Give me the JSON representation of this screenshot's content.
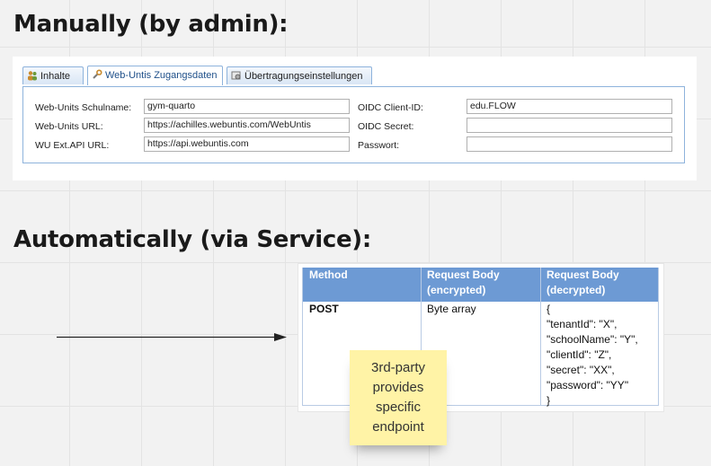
{
  "headings": {
    "manual": "Manually (by admin):",
    "automatic": "Automatically (via Service):"
  },
  "tabs": [
    {
      "label": "Inhalte",
      "icon": "people-icon",
      "active": false
    },
    {
      "label": "Web-Untis Zugangsdaten",
      "icon": "wrench-icon",
      "active": true
    },
    {
      "label": "Übertragungseinstellungen",
      "icon": "transfer-settings-icon",
      "active": false
    }
  ],
  "form": {
    "left": [
      {
        "label": "Web-Units Schulname:",
        "value": "gym-quarto"
      },
      {
        "label": "Web-Units URL:",
        "value": "https://achilles.webuntis.com/WebUntis"
      },
      {
        "label": "WU Ext.API URL:",
        "value": "https://api.webuntis.com"
      }
    ],
    "right": [
      {
        "label": "OIDC Client-ID:",
        "value": "edu.FLOW"
      },
      {
        "label": "OIDC Secret:",
        "value": ""
      },
      {
        "label": "Passwort:",
        "value": ""
      }
    ]
  },
  "api_table": {
    "headers": [
      "Method",
      "Request Body\n(encrypted)",
      "Request Body\n(decrypted)"
    ],
    "row": {
      "method": "POST",
      "encrypted": "Byte array",
      "decrypted": "{\n\"tenantId\": \"X\",\n\"schoolName\": \"Y\",\n\"clientId\": \"Z\",\n\"secret\": \"XX\",\n\"password\": \"YY\"\n}"
    },
    "colors": {
      "header_bg": "#6d9ad4",
      "header_text": "#ffffff"
    }
  },
  "sticky_note": {
    "lines": [
      "3rd-party",
      "provides",
      "specific",
      "endpoint"
    ],
    "color": "#fff3a6"
  }
}
